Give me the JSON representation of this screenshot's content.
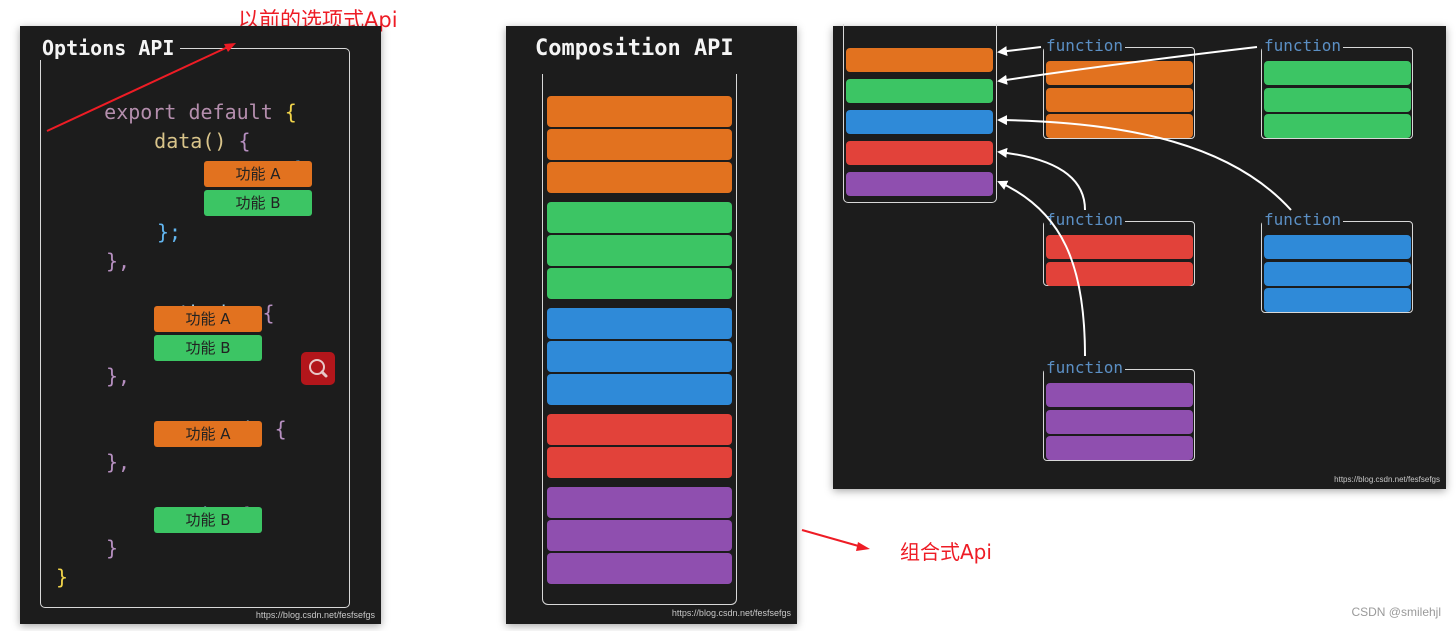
{
  "colors": {
    "orange": "#e2721f",
    "green": "#3cc564",
    "blue": "#2f8ad8",
    "red": "#e2423a",
    "purple": "#8f4faf",
    "annotation": "#ee1c25",
    "function_label": "#5b8fc4",
    "keyword": "#b48ead",
    "method": "#d9c48a",
    "property": "#9fd3ef",
    "brace_outer": "#f0d34a",
    "brace_inner": "#b68fc0",
    "brace_return": "#62b6f0"
  },
  "annotations": {
    "options_label": "以前的选项式Api",
    "composition_label": "组合式Api"
  },
  "options_panel": {
    "title": "Options API",
    "code": {
      "export_default": "export default",
      "open_brace": "{",
      "data": "data()",
      "data_brace": "{",
      "return": "return",
      "return_brace": "{",
      "return_close": "};",
      "data_close": "},",
      "methods": "methods:",
      "methods_brace": "{",
      "methods_close": "},",
      "computed": "computed:",
      "computed_brace": "{",
      "computed_close": "},",
      "watch": "watch:",
      "watch_brace": "{",
      "watch_close": "}",
      "close_brace": "}"
    },
    "features": {
      "data_a": "功能 A",
      "data_b": "功能 B",
      "methods_a": "功能 A",
      "methods_b": "功能 B",
      "computed_a": "功能 A",
      "watch_b": "功能 B"
    },
    "search_button_icon": "search-icon",
    "watermark": "https://blog.csdn.net/fesfsefgs"
  },
  "composition_panel": {
    "title": "Composition API",
    "bar_groups": [
      {
        "color": "orange",
        "count": 3
      },
      {
        "color": "green",
        "count": 3
      },
      {
        "color": "blue",
        "count": 3
      },
      {
        "color": "red",
        "count": 2
      },
      {
        "color": "purple",
        "count": 3
      }
    ],
    "watermark": "https://blog.csdn.net/fesfsefgs"
  },
  "function_panel": {
    "setup_bars": [
      "orange",
      "green",
      "blue",
      "red",
      "purple"
    ],
    "functions": [
      {
        "label": "function",
        "color": "orange",
        "count": 3
      },
      {
        "label": "function",
        "color": "green",
        "count": 3
      },
      {
        "label": "function",
        "color": "red",
        "count": 2
      },
      {
        "label": "function",
        "color": "blue",
        "count": 3
      },
      {
        "label": "function",
        "color": "purple",
        "count": 3
      }
    ],
    "watermark": "https://blog.csdn.net/fesfsefgs"
  },
  "footer": {
    "credit": "CSDN @smilehjl"
  }
}
